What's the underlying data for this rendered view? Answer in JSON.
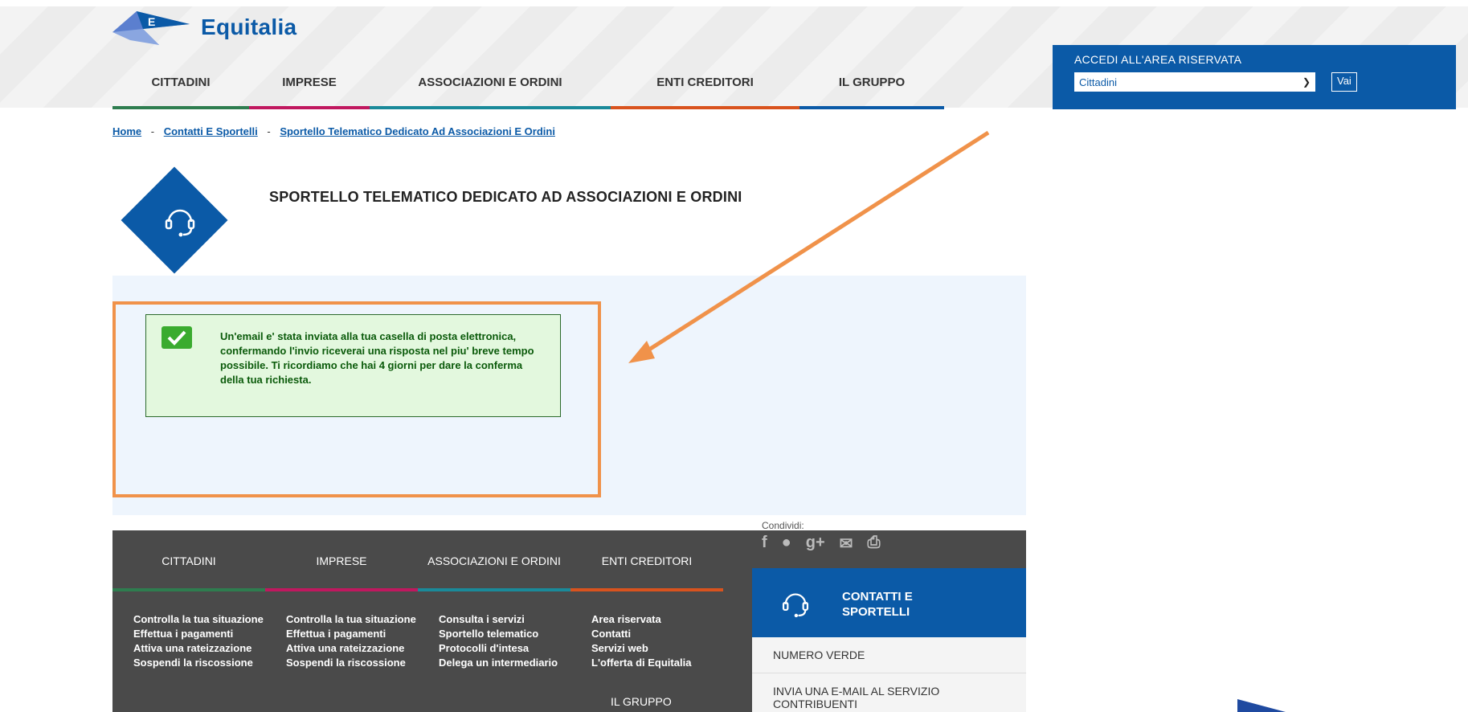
{
  "header": {
    "logo_text": "Equitalia",
    "nav": [
      {
        "label": "CITTADINI",
        "color": "#2e7d4f"
      },
      {
        "label": "IMPRESE",
        "color": "#c0185f"
      },
      {
        "label": "ASSOCIAZIONI E ORDINI",
        "color": "#1a8a9a"
      },
      {
        "label": "ENTI CREDITORI",
        "color": "#d9531e"
      },
      {
        "label": "IL GRUPPO",
        "color": "#0b5aa7"
      }
    ],
    "reserved": {
      "title": "ACCEDI ALL'AREA RISERVATA",
      "select_value": "Cittadini",
      "go_label": "Vai"
    }
  },
  "breadcrumb": {
    "items": [
      "Home",
      "Contatti E Sportelli",
      "Sportello Telematico Dedicato Ad Associazioni E Ordini"
    ],
    "separator": "-"
  },
  "page_title": "SPORTELLO TELEMATICO DEDICATO AD ASSOCIAZIONI E ORDINI",
  "message": {
    "text": "Un'email e' stata inviata alla tua casella di posta elettronica, confermando l'invio riceverai una risposta nel piu' breve tempo possibile. Ti ricordiamo che hai 4 giorni per dare la conferma della tua richiesta."
  },
  "share": {
    "label": "Condividi:"
  },
  "footer": {
    "columns": [
      {
        "label": "CITTADINI",
        "color": "#2e7d4f",
        "links": [
          "Controlla la tua situazione",
          "Effettua i pagamenti",
          "Attiva una rateizzazione",
          "Sospendi la riscossione"
        ]
      },
      {
        "label": "IMPRESE",
        "color": "#c0185f",
        "links": [
          "Controlla la tua situazione",
          "Effettua i pagamenti",
          "Attiva una rateizzazione",
          "Sospendi la riscossione"
        ]
      },
      {
        "label": "ASSOCIAZIONI E ORDINI",
        "color": "#1a8a9a",
        "links": [
          "Consulta i servizi",
          "Sportello telematico",
          "Protocolli d'intesa",
          "Delega un intermediario"
        ]
      },
      {
        "label": "ENTI CREDITORI",
        "color": "#d9531e",
        "links": [
          "Area riservata",
          "Contatti",
          "Servizi web",
          "L'offerta di Equitalia"
        ]
      }
    ],
    "gruppo_label": "IL GRUPPO"
  },
  "contacts": {
    "title": "CONTATTI E SPORTELLI",
    "items": [
      "NUMERO VERDE",
      "INVIA UNA E-MAIL AL SERVIZIO CONTRIBUENTI"
    ]
  },
  "colors": {
    "brand": "#0b5aa7",
    "annotation": "#f0924a",
    "success": "#3aab2f"
  }
}
